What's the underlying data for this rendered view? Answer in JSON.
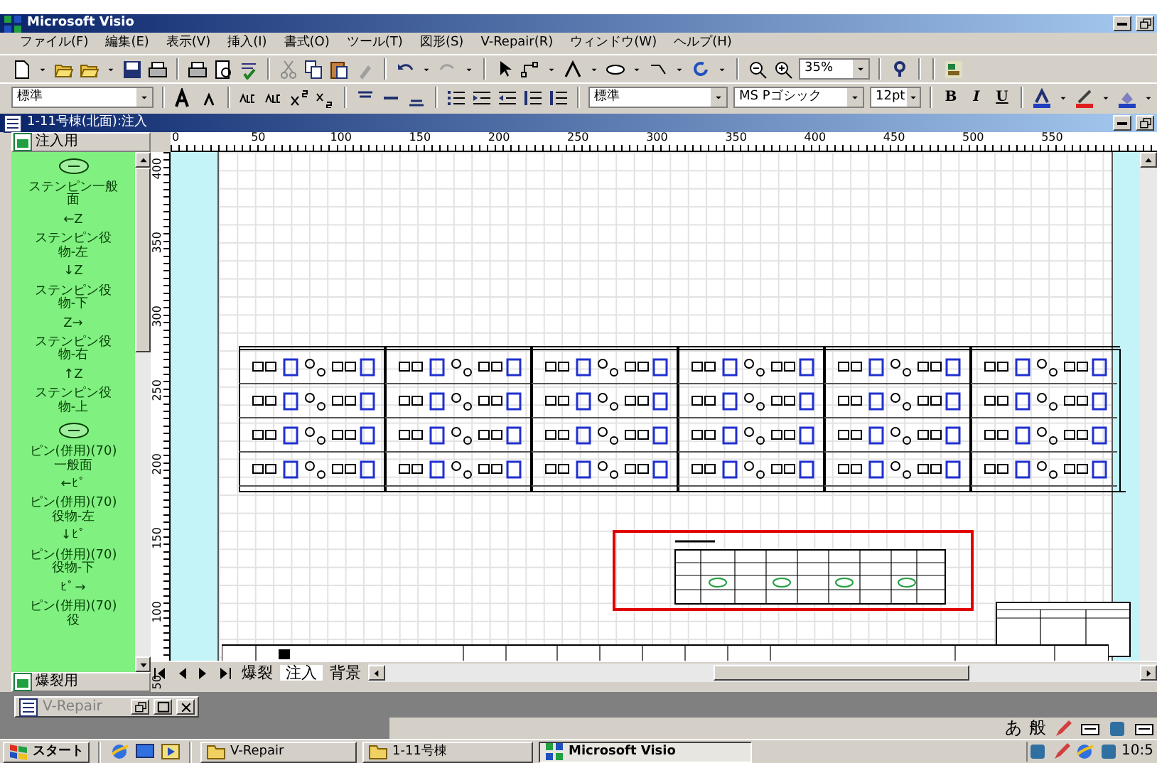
{
  "app_window": {
    "title": "Microsoft Visio"
  },
  "menu": [
    "ファイル(F)",
    "編集(E)",
    "表示(V)",
    "挿入(I)",
    "書式(O)",
    "ツール(T)",
    "図形(S)",
    "V-Repair(R)",
    "ウィンドウ(W)",
    "ヘルプ(H)"
  ],
  "toolbar_standard": {
    "zoom": "35%"
  },
  "toolbar_format": {
    "style": "標準",
    "text_style": "標準",
    "font": "MS Pゴシック",
    "size": "12pt",
    "bold": "B",
    "italic": "I",
    "underline": "U"
  },
  "document": {
    "title": "1-11号棟(北面):注入",
    "stencil": {
      "title": "注入用",
      "footer": "爆裂用",
      "items": [
        {
          "kind": "shape"
        },
        {
          "kind": "label",
          "text": "ステンピン一般面"
        },
        {
          "kind": "label",
          "text": "←Z"
        },
        {
          "kind": "label",
          "text": "ステンピン役物-左"
        },
        {
          "kind": "label",
          "text": "↓Z"
        },
        {
          "kind": "label",
          "text": "ステンピン役物-下"
        },
        {
          "kind": "label",
          "text": "Z→"
        },
        {
          "kind": "label",
          "text": "ステンピン役物-右"
        },
        {
          "kind": "label",
          "text": "↑Z"
        },
        {
          "kind": "label",
          "text": "ステンピン役物-上"
        },
        {
          "kind": "shape"
        },
        {
          "kind": "label",
          "text": "ピン(併用)(70)一般面"
        },
        {
          "kind": "label",
          "text": "←ﾋﾟ"
        },
        {
          "kind": "label",
          "text": "ピン(併用)(70)役物-左"
        },
        {
          "kind": "label",
          "text": "↓ﾋﾟ"
        },
        {
          "kind": "label",
          "text": "ピン(併用)(70)役物-下"
        },
        {
          "kind": "label",
          "text": "ﾋﾟ→"
        },
        {
          "kind": "label",
          "text": "ピン(併用)(70)役"
        }
      ]
    },
    "ruler_h": [
      "0",
      "50",
      "100",
      "150",
      "200",
      "250",
      "300",
      "350",
      "400",
      "450",
      "500",
      "550"
    ],
    "ruler_v": [
      "400",
      "350",
      "300",
      "250",
      "200",
      "150",
      "100",
      "50"
    ],
    "page_tabs": [
      {
        "label": "爆裂",
        "selected": false
      },
      {
        "label": "注入",
        "selected": true
      },
      {
        "label": "背景",
        "selected": false
      }
    ]
  },
  "minimized_window": {
    "title": "V-Repair"
  },
  "ime_bar": [
    "あ",
    "般"
  ],
  "taskbar": {
    "start": "スタート",
    "buttons": [
      {
        "label": "V-Repair",
        "selected": false
      },
      {
        "label": "1-11号棟",
        "selected": false
      },
      {
        "label": "Microsoft Visio",
        "selected": true
      }
    ],
    "clock": "10:5"
  }
}
